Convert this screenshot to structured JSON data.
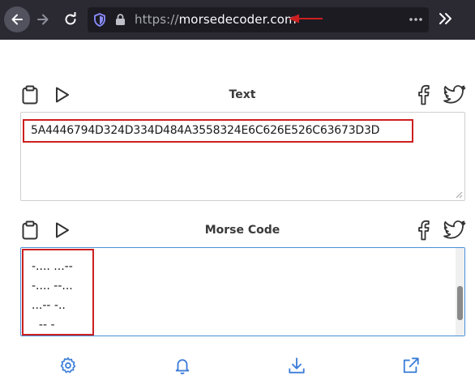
{
  "browser": {
    "url_scheme": "https://",
    "url_host": "morsedecoder.com",
    "colors": {
      "toolbar": "#2b2a33",
      "urlbar": "#1c1b22",
      "annotation": "#cc1f1f"
    }
  },
  "text_section": {
    "title": "Text",
    "value": "5A4446794D324D334D484A3558324E6C626E526C63673D3D"
  },
  "morse_section": {
    "title": "Morse Code",
    "lines": [
      "-.... ...--",
      "-.... --...",
      "...-- -..",
      "  -- -"
    ]
  },
  "icons": {
    "copy": "clipboard-icon",
    "play": "play-icon",
    "facebook": "facebook-icon",
    "twitter": "twitter-icon",
    "settings": "gear-icon",
    "notify": "bell-icon",
    "download": "download-icon",
    "share": "external-link-icon"
  },
  "accent_color": "#3b7dd8"
}
